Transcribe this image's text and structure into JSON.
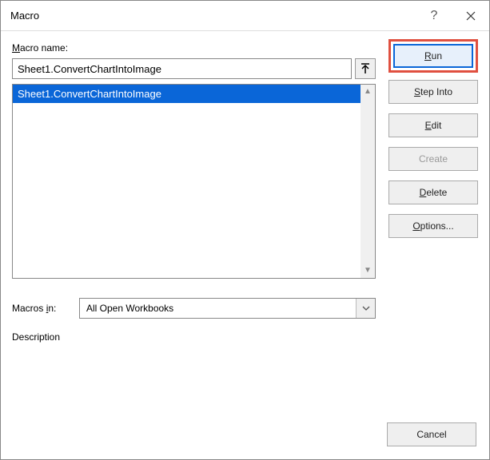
{
  "window": {
    "title": "Macro",
    "help_icon": "?",
    "close_icon": "✕"
  },
  "labels": {
    "macro_name_prefix": "M",
    "macro_name_suffix": "acro name:",
    "macros_in_prefix": "Macros ",
    "macros_in_underline": "i",
    "macros_in_suffix": "n:",
    "description": "Description"
  },
  "macro_name": {
    "value": "Sheet1.ConvertChartIntoImage"
  },
  "macro_list": [
    {
      "label": "Sheet1.ConvertChartIntoImage",
      "selected": true
    }
  ],
  "macros_in": {
    "value": "All Open Workbooks"
  },
  "buttons": {
    "run_u": "R",
    "run_rest": "un",
    "step_u": "S",
    "step_rest": "tep Into",
    "edit_u": "E",
    "edit_rest": "dit",
    "create": "Create",
    "delete_u": "D",
    "delete_rest": "elete",
    "options_u": "O",
    "options_rest": "ptions...",
    "cancel": "Cancel"
  }
}
